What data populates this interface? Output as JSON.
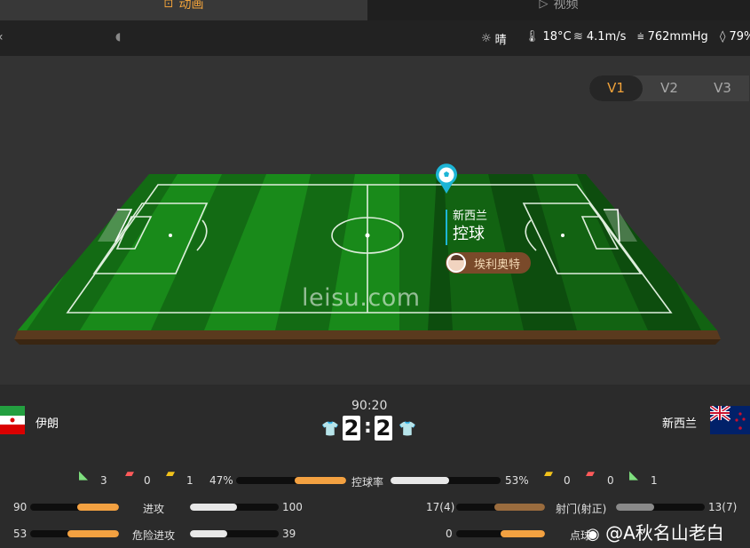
{
  "tabs": {
    "animation": "动画",
    "video": "视频"
  },
  "weather": {
    "condition": "晴",
    "temperature": "18°C",
    "wind": "4.1m/s",
    "pressure": "762mmHg",
    "humidity": "79%"
  },
  "view_tabs": [
    "V1",
    "V2",
    "V3"
  ],
  "field": {
    "watermark": "leisu.com",
    "event_team": "新西兰",
    "event_action": "控球",
    "player": "埃利奥特"
  },
  "match": {
    "time": "90:20",
    "home": "伊朗",
    "away": "新西兰",
    "home_score": "2",
    "away_score": "2",
    "colon": ":"
  },
  "stats": {
    "home_corners": "3",
    "home_red": "0",
    "home_yellow": "1",
    "home_possession": "47%",
    "possession_label": "控球率",
    "away_possession": "53%",
    "away_yellow": "0",
    "away_red": "0",
    "away_corners": "1",
    "home_attacks": "90",
    "attacks_label": "进攻",
    "away_attacks": "100",
    "home_shots": "17(4)",
    "shots_label": "射门(射正)",
    "away_shots": "13(7)",
    "home_dangerous": "53",
    "dangerous_label": "危险进攻",
    "away_dangerous": "39",
    "home_penalty": "0",
    "penalty_label": "点球"
  },
  "bars": {
    "possession_home": 0.47,
    "possession_away": 0.53,
    "attacks_home": 0.47,
    "attacks_away": 0.53,
    "dangerous_home": 0.58,
    "dangerous_away": 0.42,
    "shots_home": 0.57,
    "shots_away": 0.43
  },
  "watermark_weibo": "@A秋名山老白",
  "colors": {
    "accent": "#f2a33a",
    "pitch": "#1a8a1a"
  }
}
